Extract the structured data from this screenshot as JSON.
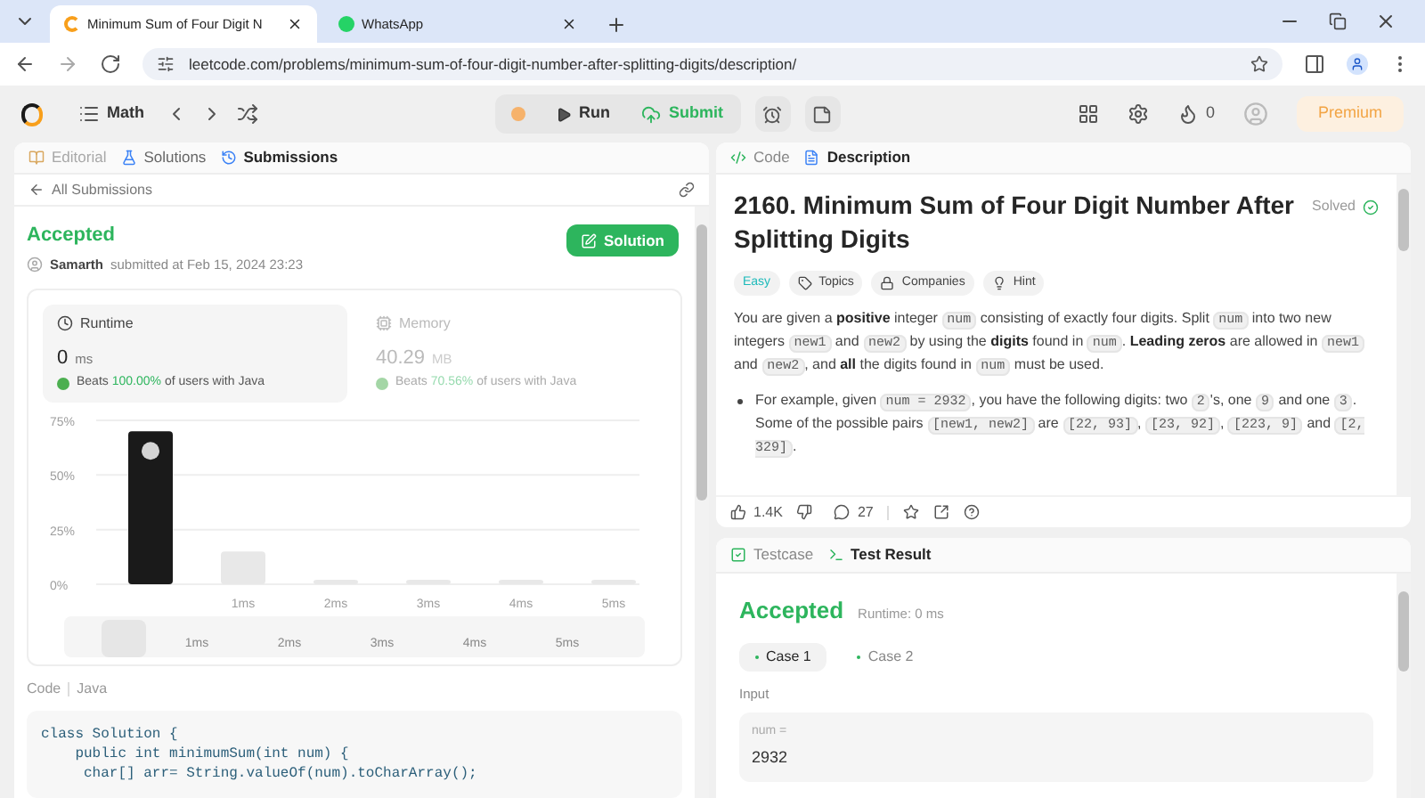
{
  "browser": {
    "tabs": [
      {
        "title": "Minimum Sum of Four Digit N",
        "selected": true
      },
      {
        "title": "WhatsApp",
        "selected": false
      }
    ],
    "url": "leetcode.com/problems/minimum-sum-of-four-digit-number-after-splitting-digits/description/"
  },
  "toolbar": {
    "problem_list": "Math",
    "run": "Run",
    "submit": "Submit",
    "streak": "0",
    "premium": "Premium"
  },
  "left_panel": {
    "tabs": [
      {
        "label": "Editorial",
        "selected": false,
        "disabled": true
      },
      {
        "label": "Solutions",
        "selected": false,
        "disabled": false
      },
      {
        "label": "Submissions",
        "selected": true,
        "disabled": false
      }
    ],
    "back_link": "All Submissions",
    "status": "Accepted",
    "user": "Samarth",
    "submitted": "submitted at Feb 15, 2024 23:23",
    "solution_button": "Solution",
    "stats": [
      {
        "kind": "runtime",
        "label": "Runtime",
        "value": "0",
        "unit": "ms",
        "beats": "Beats",
        "percent": "100.00%",
        "suffix": "of users with Java",
        "selected": true
      },
      {
        "kind": "memory",
        "label": "Memory",
        "value": "40.29",
        "unit": "MB",
        "beats": "Beats",
        "percent": "70.56%",
        "suffix": "of users with Java",
        "selected": false
      }
    ],
    "chart_data": {
      "type": "bar",
      "categories": [
        null,
        "1ms",
        "2ms",
        "3ms",
        "4ms",
        "5ms"
      ],
      "values": [
        70,
        15,
        2,
        2,
        2,
        2
      ],
      "ylim": [
        0,
        75
      ],
      "yticks": [
        {
          "value": 0,
          "label": "0%"
        },
        {
          "value": 25,
          "label": "25%"
        },
        {
          "value": 50,
          "label": "50%"
        },
        {
          "value": 75,
          "label": "75%"
        }
      ]
    },
    "overview_labels": [
      "1ms",
      "2ms",
      "3ms",
      "4ms",
      "5ms"
    ],
    "code_label": "Code",
    "language": "Java",
    "code_lines": [
      "class Solution {",
      "    public int minimumSum(int num) {",
      "     char[] arr= String.valueOf(num).toCharArray();"
    ]
  },
  "description_panel": {
    "tabs": [
      {
        "label": "Code",
        "selected": false
      },
      {
        "label": "Description",
        "selected": true
      }
    ],
    "title": "2160. Minimum Sum of Four Digit Number After Splitting Digits",
    "solved": "Solved",
    "tags": [
      {
        "kind": "difficulty",
        "label": "Easy"
      },
      {
        "kind": "topics",
        "label": "Topics"
      },
      {
        "kind": "companies",
        "label": "Companies"
      },
      {
        "kind": "hint",
        "label": "Hint"
      }
    ],
    "paragraph": [
      {
        "kind": "text",
        "text": "You are given a "
      },
      {
        "kind": "bold",
        "text": "positive"
      },
      {
        "kind": "text",
        "text": " integer "
      },
      {
        "kind": "code",
        "text": "num"
      },
      {
        "kind": "text",
        "text": " consisting of exactly four digits. Split "
      },
      {
        "kind": "code",
        "text": "num"
      },
      {
        "kind": "text",
        "text": " into two new integers "
      },
      {
        "kind": "code",
        "text": "new1"
      },
      {
        "kind": "text",
        "text": " and "
      },
      {
        "kind": "code",
        "text": "new2"
      },
      {
        "kind": "text",
        "text": " by using the "
      },
      {
        "kind": "bold",
        "text": "digits"
      },
      {
        "kind": "text",
        "text": " found in "
      },
      {
        "kind": "code",
        "text": "num"
      },
      {
        "kind": "text",
        "text": ". "
      },
      {
        "kind": "bold",
        "text": "Leading zeros"
      },
      {
        "kind": "text",
        "text": " are allowed in "
      },
      {
        "kind": "code",
        "text": "new1"
      },
      {
        "kind": "text",
        "text": " and "
      },
      {
        "kind": "code",
        "text": "new2"
      },
      {
        "kind": "text",
        "text": ", and "
      },
      {
        "kind": "bold",
        "text": "all"
      },
      {
        "kind": "text",
        "text": " the digits found in "
      },
      {
        "kind": "code",
        "text": "num"
      },
      {
        "kind": "text",
        "text": " must be used."
      }
    ],
    "bullet": [
      {
        "kind": "text",
        "text": "For example, given "
      },
      {
        "kind": "code",
        "text": "num = 2932"
      },
      {
        "kind": "text",
        "text": ", you have the following digits: two "
      },
      {
        "kind": "code",
        "text": "2"
      },
      {
        "kind": "text",
        "text": "'s, one "
      },
      {
        "kind": "code",
        "text": "9"
      },
      {
        "kind": "text",
        "text": " and one "
      },
      {
        "kind": "code",
        "text": "3"
      },
      {
        "kind": "text",
        "text": ". Some of the possible pairs "
      },
      {
        "kind": "code",
        "text": "[new1, new2]"
      },
      {
        "kind": "text",
        "text": " are "
      },
      {
        "kind": "code",
        "text": "[22, 93]"
      },
      {
        "kind": "text",
        "text": ", "
      },
      {
        "kind": "code",
        "text": "[23, 92]"
      },
      {
        "kind": "text",
        "text": ", "
      },
      {
        "kind": "code",
        "text": "[223, 9]"
      },
      {
        "kind": "text",
        "text": " and "
      },
      {
        "kind": "code",
        "text": "[2, 329]"
      },
      {
        "kind": "text",
        "text": "."
      }
    ],
    "likes": "1.4K",
    "comments": "27"
  },
  "result_panel": {
    "tabs": [
      {
        "label": "Testcase",
        "selected": false
      },
      {
        "label": "Test Result",
        "selected": true
      }
    ],
    "status": "Accepted",
    "runtime": "Runtime: 0 ms",
    "cases": [
      {
        "label": "Case 1",
        "selected": true
      },
      {
        "label": "Case 2",
        "selected": false
      }
    ],
    "input_label": "Input",
    "variable": "num =",
    "value": "2932"
  }
}
